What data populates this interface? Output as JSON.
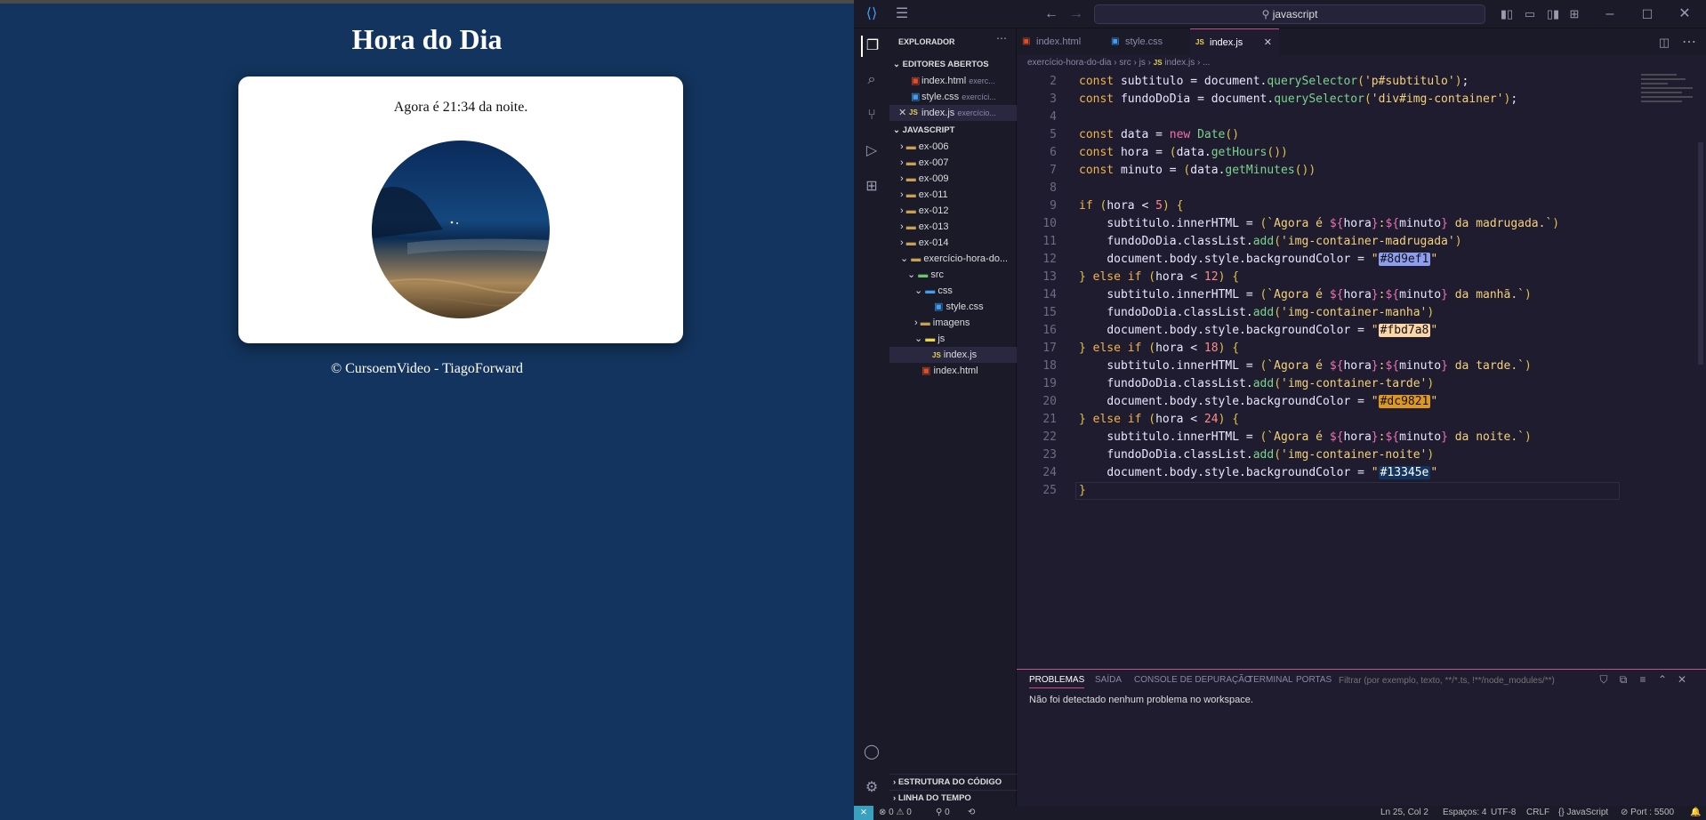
{
  "page": {
    "title": "Hora do Dia",
    "message": "Agora é 21:34 da noite.",
    "footer": "© CursoemVideo - TiagoForward"
  },
  "vscode": {
    "search_text": "javascript",
    "explorer_title": "EXPLORADOR",
    "open_editors_title": "EDITORES ABERTOS",
    "open_editors": [
      {
        "name": "index.html",
        "desc": "exerc..."
      },
      {
        "name": "style.css",
        "desc": "exercíci..."
      },
      {
        "name": "index.js",
        "desc": "exercício..."
      }
    ],
    "project_title": "JAVASCRIPT",
    "folders": [
      "ex-006",
      "ex-007",
      "ex-009",
      "ex-011",
      "ex-012",
      "ex-013",
      "ex-014",
      "exercício-hora-do..."
    ],
    "tree": {
      "src": "src",
      "css": "css",
      "style_css": "style.css",
      "imagens": "imagens",
      "js": "js",
      "index_js": "index.js",
      "index_html": "index.html"
    },
    "outline_title": "ESTRUTURA DO CÓDIGO",
    "timeline_title": "LINHA DO TEMPO",
    "tabs": [
      "index.html",
      "style.css",
      "index.js"
    ],
    "breadcrumb": [
      "exercício-hora-do-dia",
      "src",
      "js",
      "index.js",
      "..."
    ],
    "code_lines": [
      {
        "n": "2",
        "code": "const subtitulo = document.querySelector('p#subtitulo');"
      },
      {
        "n": "3",
        "code": "const fundoDoDia = document.querySelector('div#img-container');"
      },
      {
        "n": "4",
        "code": ""
      },
      {
        "n": "5",
        "code": "const data = new Date()"
      },
      {
        "n": "6",
        "code": "const hora = (data.getHours())"
      },
      {
        "n": "7",
        "code": "const minuto = (data.getMinutes())"
      },
      {
        "n": "8",
        "code": ""
      },
      {
        "n": "9",
        "code": "if (hora < 5) {"
      },
      {
        "n": "10",
        "code": "    subtitulo.innerHTML = (`Agora é ${hora}:${minuto} da madrugada.`)"
      },
      {
        "n": "11",
        "code": "    fundoDoDia.classList.add('img-container-madrugada')"
      },
      {
        "n": "12",
        "code": "    document.body.style.backgroundColor = \"#8d9ef1\""
      },
      {
        "n": "13",
        "code": "} else if (hora < 12) {"
      },
      {
        "n": "14",
        "code": "    subtitulo.innerHTML = (`Agora é ${hora}:${minuto} da manhã.`)"
      },
      {
        "n": "15",
        "code": "    fundoDoDia.classList.add('img-container-manha')"
      },
      {
        "n": "16",
        "code": "    document.body.style.backgroundColor = \"#fbd7a8\""
      },
      {
        "n": "17",
        "code": "} else if (hora < 18) {"
      },
      {
        "n": "18",
        "code": "    subtitulo.innerHTML = (`Agora é ${hora}:${minuto} da tarde.`)"
      },
      {
        "n": "19",
        "code": "    fundoDoDia.classList.add('img-container-tarde')"
      },
      {
        "n": "20",
        "code": "    document.body.style.backgroundColor = \"#dc9821\""
      },
      {
        "n": "21",
        "code": "} else if (hora < 24) {"
      },
      {
        "n": "22",
        "code": "    subtitulo.innerHTML = (`Agora é ${hora}:${minuto} da noite.`)"
      },
      {
        "n": "23",
        "code": "    fundoDoDia.classList.add('img-container-noite')"
      },
      {
        "n": "24",
        "code": "    document.body.style.backgroundColor = \"#13345e\""
      },
      {
        "n": "25",
        "code": "}"
      }
    ],
    "swatches": {
      "madrugada": "#8d9ef1",
      "manha": "#fbd7a8",
      "tarde": "#dc9821",
      "noite": "#13345e"
    },
    "panel_tabs": [
      "PROBLEMAS",
      "SAÍDA",
      "CONSOLE DE DEPURAÇÃO",
      "TERMINAL",
      "PORTAS"
    ],
    "filter_placeholder": "Filtrar (por exemplo, texto, **/*.ts, !**/node_modules/**)",
    "panel_message": "Não foi detectado nenhum problema no workspace.",
    "status": {
      "errors": "0",
      "warnings": "0",
      "ports": "0",
      "position": "Ln 25, Col 2",
      "spaces": "Espaços: 4",
      "encoding": "UTF-8",
      "eol": "CRLF",
      "language": "JavaScript",
      "port": "Port : 5500"
    }
  }
}
